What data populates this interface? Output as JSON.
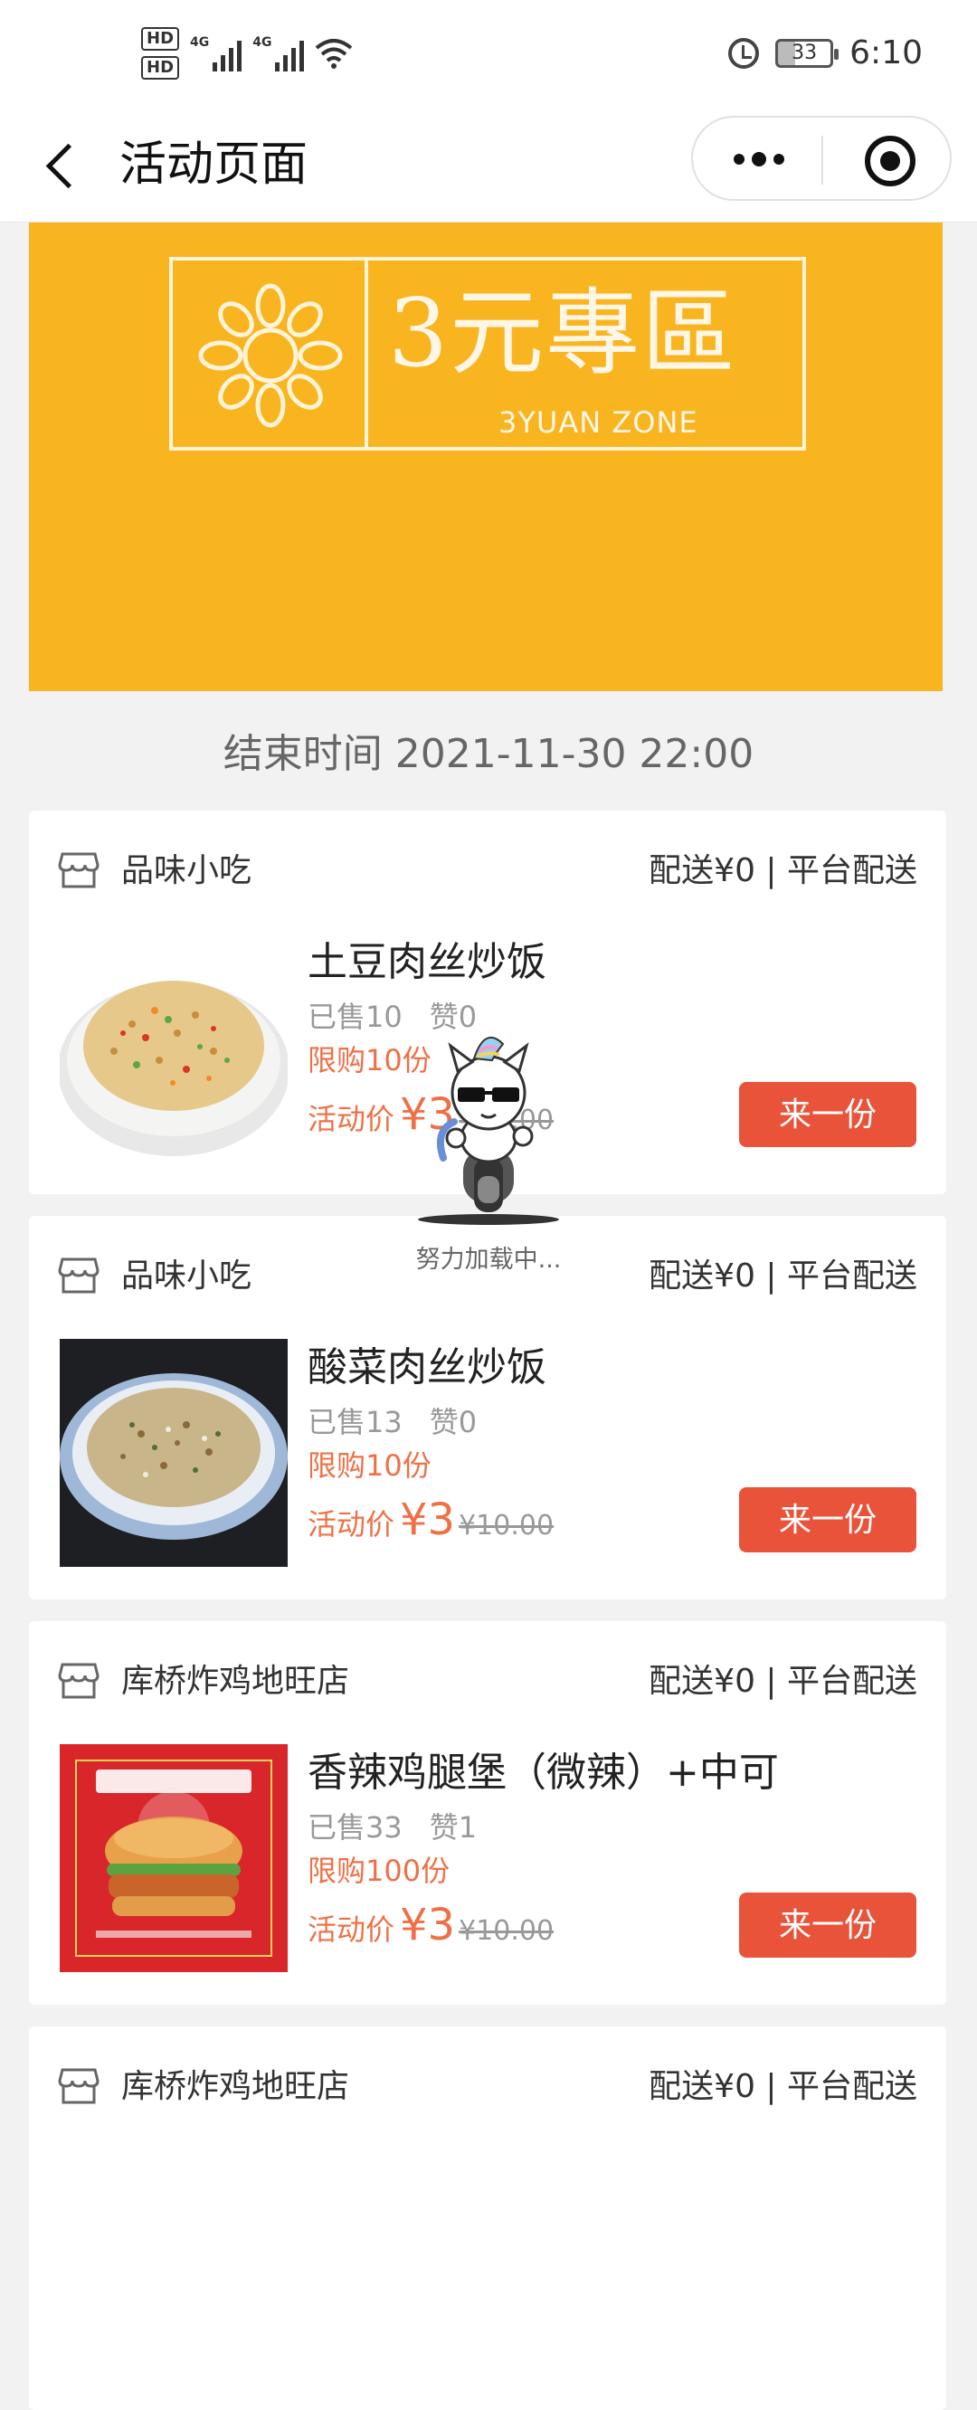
{
  "status_bar": {
    "hd1": "HD",
    "hd2": "HD",
    "sig1": "4G",
    "sig2": "4G",
    "battery": "33",
    "time": "6:10",
    "icons": [
      "hd-icon",
      "signal-icon",
      "wifi-icon",
      "alarm-icon",
      "battery-icon"
    ]
  },
  "nav": {
    "title": "活动页面",
    "back_icon": "chevron-left-icon",
    "more_icon": "more-dots-icon",
    "close_icon": "target-circle-icon"
  },
  "banner": {
    "title": "3元專區",
    "subtitle": "3YUAN ZONE",
    "bg_color": "#f8b520"
  },
  "end_time": "结束时间 2021-11-30 22:00",
  "products": [
    {
      "shop": "品味小吃",
      "delivery": "配送¥0 | 平台配送",
      "name": "土豆肉丝炒饭",
      "sold": "已售10",
      "likes": "赞0",
      "limit": "限购10份",
      "price_label": "活动价",
      "price": "¥3",
      "old_price": "¥10.00",
      "button": "来一份"
    },
    {
      "shop": "品味小吃",
      "delivery": "配送¥0 | 平台配送",
      "name": "酸菜肉丝炒饭",
      "sold": "已售13",
      "likes": "赞0",
      "limit": "限购10份",
      "price_label": "活动价",
      "price": "¥3",
      "old_price": "¥10.00",
      "button": "来一份"
    },
    {
      "shop": "库桥炸鸡地旺店",
      "delivery": "配送¥0 | 平台配送",
      "name": "香辣鸡腿堡（微辣）+中可",
      "sold": "已售33",
      "likes": "赞1",
      "limit": "限购100份",
      "price_label": "活动价",
      "price": "¥3",
      "old_price": "¥10.00",
      "button": "来一份"
    },
    {
      "shop": "库桥炸鸡地旺店",
      "delivery": "配送¥0 | 平台配送"
    }
  ],
  "loading": {
    "text": "努力加载中..."
  },
  "accent_color": "#e8533a",
  "price_color": "#f07046"
}
